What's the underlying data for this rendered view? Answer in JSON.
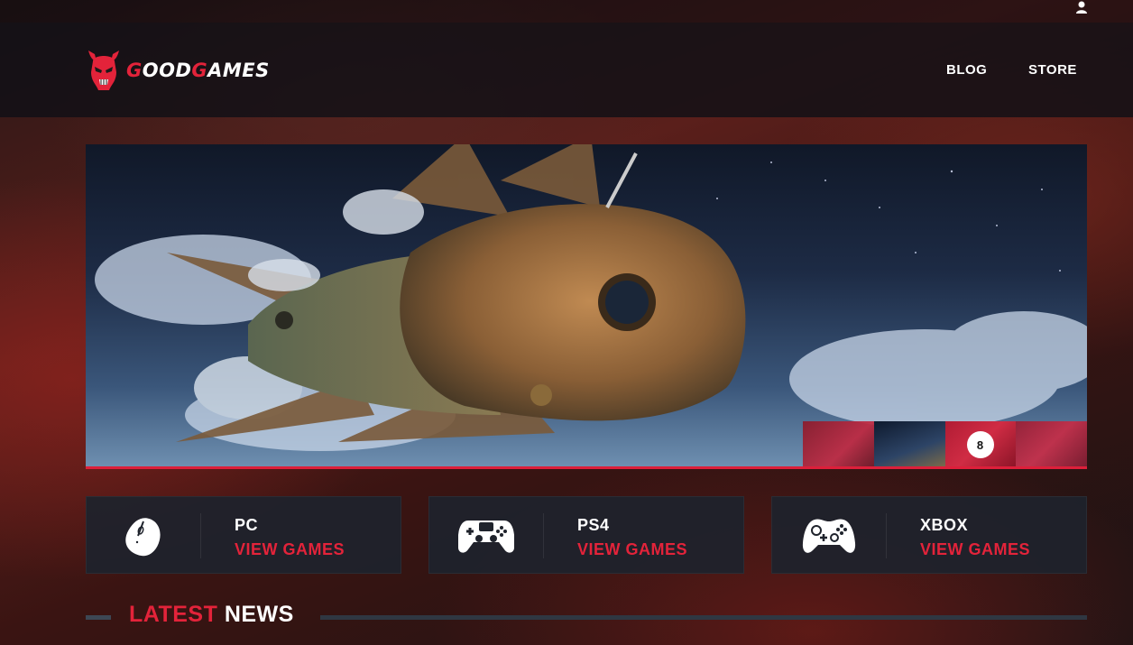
{
  "topbar": {
    "user_icon": "user-icon"
  },
  "header": {
    "logo": {
      "part1": "G",
      "part2": "OOD",
      "part3": "G",
      "part4": "AMES",
      "icon": "demon-skull-icon",
      "accent": "#e3233a"
    },
    "nav": [
      {
        "label": "BLOG"
      },
      {
        "label": "STORE"
      }
    ]
  },
  "hero": {
    "image": "steampunk-flying-fish-airship",
    "accent": "#dd1f3a",
    "thumbnails": [
      {
        "image": "red-thumb"
      },
      {
        "image": "airship-thumb"
      },
      {
        "image": "red-thumb",
        "badge": "8"
      },
      {
        "image": "red-thumb"
      }
    ]
  },
  "platforms": [
    {
      "name": "PC",
      "link": "VIEW GAMES",
      "icon": "mouse-icon"
    },
    {
      "name": "PS4",
      "link": "VIEW GAMES",
      "icon": "ps4-controller-icon"
    },
    {
      "name": "XBOX",
      "link": "VIEW GAMES",
      "icon": "xbox-controller-icon"
    }
  ],
  "news": {
    "title_accent": "LATEST",
    "title_rest": "NEWS"
  }
}
